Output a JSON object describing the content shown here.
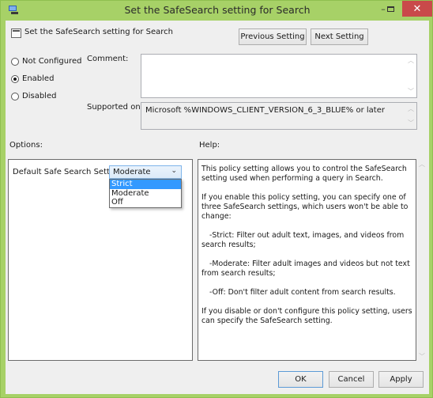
{
  "window": {
    "title": "Set the SafeSearch setting for Search",
    "controls": {
      "minimize": "–",
      "maximize": "□",
      "close": "✕"
    },
    "accent_color": "#a7d167",
    "close_color": "#c94a4a"
  },
  "header": {
    "policy_name": "Set the SafeSearch setting for Search",
    "prev_button": "Previous Setting",
    "next_button": "Next Setting"
  },
  "state": {
    "options": [
      {
        "label": "Not Configured",
        "checked": false
      },
      {
        "label": "Enabled",
        "checked": true
      },
      {
        "label": "Disabled",
        "checked": false
      }
    ]
  },
  "comment": {
    "label": "Comment:",
    "value": ""
  },
  "supported": {
    "label": "Supported on:",
    "value": "Microsoft %WINDOWS_CLIENT_VERSION_6_3_BLUE% or later"
  },
  "options_section": {
    "label": "Options:",
    "setting_label": "Default Safe Search Setting",
    "selected": "Moderate",
    "dropdown_items": [
      "Strict",
      "Moderate",
      "Off"
    ],
    "highlighted": "Strict"
  },
  "help_section": {
    "label": "Help:",
    "paragraphs": [
      "This policy setting allows you to control the SafeSearch setting used when performing a query in Search.",
      "If you enable this policy setting, you can specify one of three SafeSearch settings, which users won't be able to change:",
      "-Strict: Filter out adult text, images, and videos from search results;",
      "-Moderate: Filter adult images and videos but not text from search results;",
      "-Off: Don't filter adult content from search results.",
      "If you disable or don't configure this policy setting, users can specify the SafeSearch setting."
    ]
  },
  "footer": {
    "ok": "OK",
    "cancel": "Cancel",
    "apply": "Apply"
  }
}
